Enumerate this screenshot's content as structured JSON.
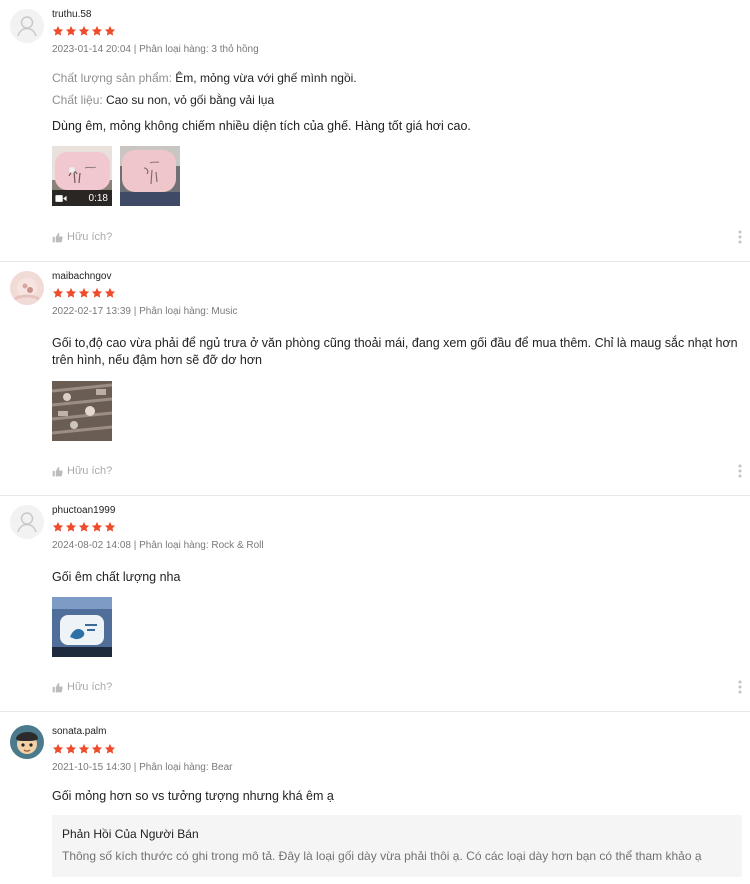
{
  "colors": {
    "star": "#ee4d2d",
    "accent": "#ee4d2d"
  },
  "common": {
    "helpful_label": "Hữu ích?",
    "avatar_icon": "user-placeholder-icon",
    "star_icon": "star-filled-icon"
  },
  "reviews": [
    {
      "author": "truthu.58",
      "rating": 5,
      "meta": "2023-01-14 20:04 | Phân loại hàng: 3 thỏ hồng",
      "attributes": [
        {
          "key": "Chất lượng sản phẩm:",
          "value": " Êm, mỏng vừa với ghế mình ngồi."
        },
        {
          "key": "Chất liệu:",
          "value": " Cao su non, vỏ gối bằng vải lụa"
        }
      ],
      "content": "Dùng êm, mỏng không chiếm nhiều diện tích của ghế. Hàng tốt giá hơi cao.",
      "media": [
        {
          "type": "video",
          "duration": "0:18"
        },
        {
          "type": "image"
        }
      ]
    },
    {
      "author": "maibachngov",
      "rating": 5,
      "meta": "2022-02-17 13:39 | Phân loại hàng: Music",
      "content": "Gối to,độ cao vừa phải để ngủ trưa ở văn phòng cũng thoải mái, đang xem gối đầu để mua thêm. Chỉ là maug sắc nhạt hơn trên hình, nếu đậm hơn sẽ đỡ dơ hơn",
      "media": [
        {
          "type": "image"
        }
      ]
    },
    {
      "author": "phuctoan1999",
      "rating": 5,
      "meta": "2024-08-02 14:08 | Phân loại hàng: Rock & Roll",
      "content": "Gối êm chất lượng nha",
      "media": [
        {
          "type": "image"
        }
      ]
    },
    {
      "author": "sonata.palm",
      "rating": 5,
      "meta": "2021-10-15 14:30 | Phân loại hàng: Bear",
      "content": "Gối mỏng hơn so vs tưởng tượng nhưng khá êm ạ",
      "seller_reply": {
        "title": "Phản Hồi Của Người Bán",
        "body": "Thông số kích thước có ghi trong mô tả. Đây là loại gối dày vừa phải thôi ạ. Có các loại dày hơn bạn có thể tham khảo ạ"
      }
    }
  ]
}
